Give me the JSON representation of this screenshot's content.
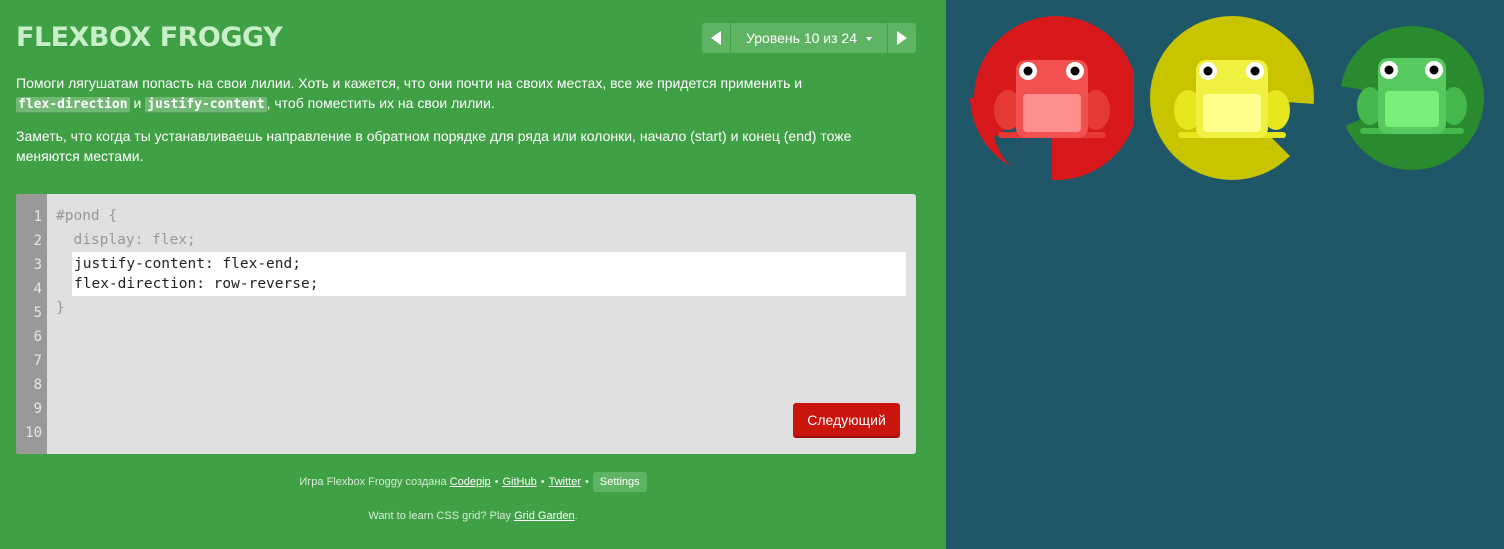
{
  "header": {
    "title": "FLEXBOX FROGGY",
    "level_label": "Уровень 10 из 24"
  },
  "instructions": {
    "p1_text_1": "Помоги лягушатам попасть на свои лилии. Хоть и кажется, что они почти на своих местах, все же придется применить и",
    "p1_code_1": "flex-direction",
    "p1_text_2": "и",
    "p1_code_2": "justify-content",
    "p1_text_3": ", чтоб поместить их на свои лилии.",
    "p2": "Заметь, что когда ты устанавливаешь направление в обратном порядке для ряда или колонки, начало (start) и конец (end) тоже меняются местами."
  },
  "editor": {
    "line_numbers": [
      "1",
      "2",
      "3",
      "4",
      "5",
      "6",
      "7",
      "8",
      "9",
      "10"
    ],
    "before": [
      "#pond {",
      "  display: flex;"
    ],
    "input": [
      "justify-content: flex-end;",
      "flex-direction: row-reverse;"
    ],
    "after": [
      "}"
    ],
    "next_label": "Следующий"
  },
  "footer": {
    "credits_prefix": "Игра Flexbox Froggy создана",
    "codepip": "Codepip",
    "github": "GitHub",
    "twitter": "Twitter",
    "settings": "Settings",
    "grid_prefix": "Want to learn CSS grid? Play",
    "grid_link": "Grid Garden",
    "grid_suffix": "."
  },
  "board": {
    "lilypads": [
      {
        "color": "red",
        "hex": "#d7191c"
      },
      {
        "color": "yellow",
        "hex": "#c8c400"
      },
      {
        "color": "green",
        "hex": "#2a8a30"
      }
    ],
    "frogs": [
      {
        "color": "red",
        "body": "#f2524f",
        "belly": "#ff8f8c"
      },
      {
        "color": "yellow",
        "body": "#f0f043",
        "belly": "#ffff8c"
      },
      {
        "color": "green",
        "body": "#58c95e",
        "belly": "#7af07a"
      }
    ]
  },
  "colors": {
    "sidebar_bg": "#40a045",
    "board_bg": "#1f5768",
    "next_button": "#c9150c"
  }
}
